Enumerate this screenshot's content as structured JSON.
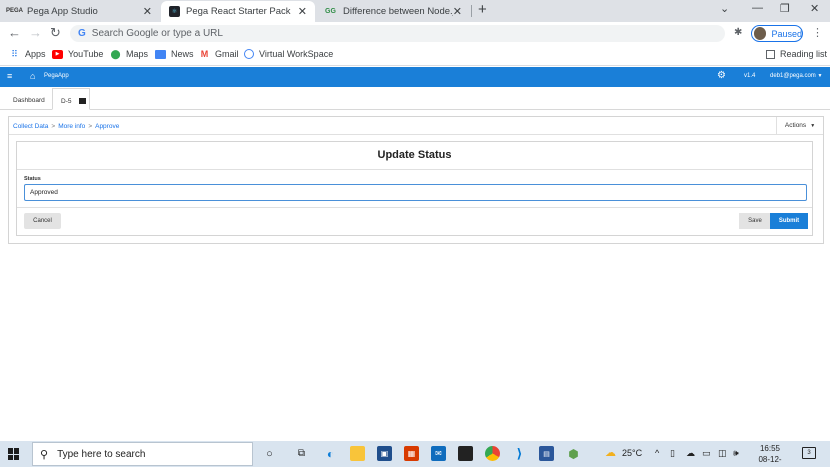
{
  "browser": {
    "tabs": [
      {
        "label": "Pega App Studio",
        "favicon": "PEGA"
      },
      {
        "label": "Pega React Starter Pack",
        "favicon": "react"
      },
      {
        "label": "Difference between Node.js and",
        "favicon": "gfg"
      }
    ],
    "address_placeholder": "Search Google or type a URL",
    "profile_status": "Paused",
    "bookmarks": [
      {
        "label": "Apps"
      },
      {
        "label": "YouTube"
      },
      {
        "label": "Maps"
      },
      {
        "label": "News"
      },
      {
        "label": "Gmail"
      },
      {
        "label": "Virtual WorkSpace"
      }
    ],
    "reading_list": "Reading list"
  },
  "app": {
    "name": "PegaApp",
    "version": "v1.4",
    "user": "deb1@pega.com",
    "worktabs": [
      {
        "label": "Dashboard"
      },
      {
        "label": "D-5"
      }
    ],
    "breadcrumbs": [
      "Collect Data",
      "More info",
      "Approve"
    ],
    "actions_label": "Actions",
    "form": {
      "title": "Update Status",
      "status_label": "Status",
      "status_value": "Approved",
      "cancel_label": "Cancel",
      "save_label": "Save",
      "submit_label": "Submit"
    }
  },
  "taskbar": {
    "search_placeholder": "Type here to search",
    "temperature": "25°C",
    "time": "16:55",
    "date": "08-12-2021",
    "notification_count": "3"
  },
  "colors": {
    "pega_blue": "#1a7fd8",
    "chrome_tabbar": "#dee1e6",
    "taskbar": "#d9e4ef"
  }
}
